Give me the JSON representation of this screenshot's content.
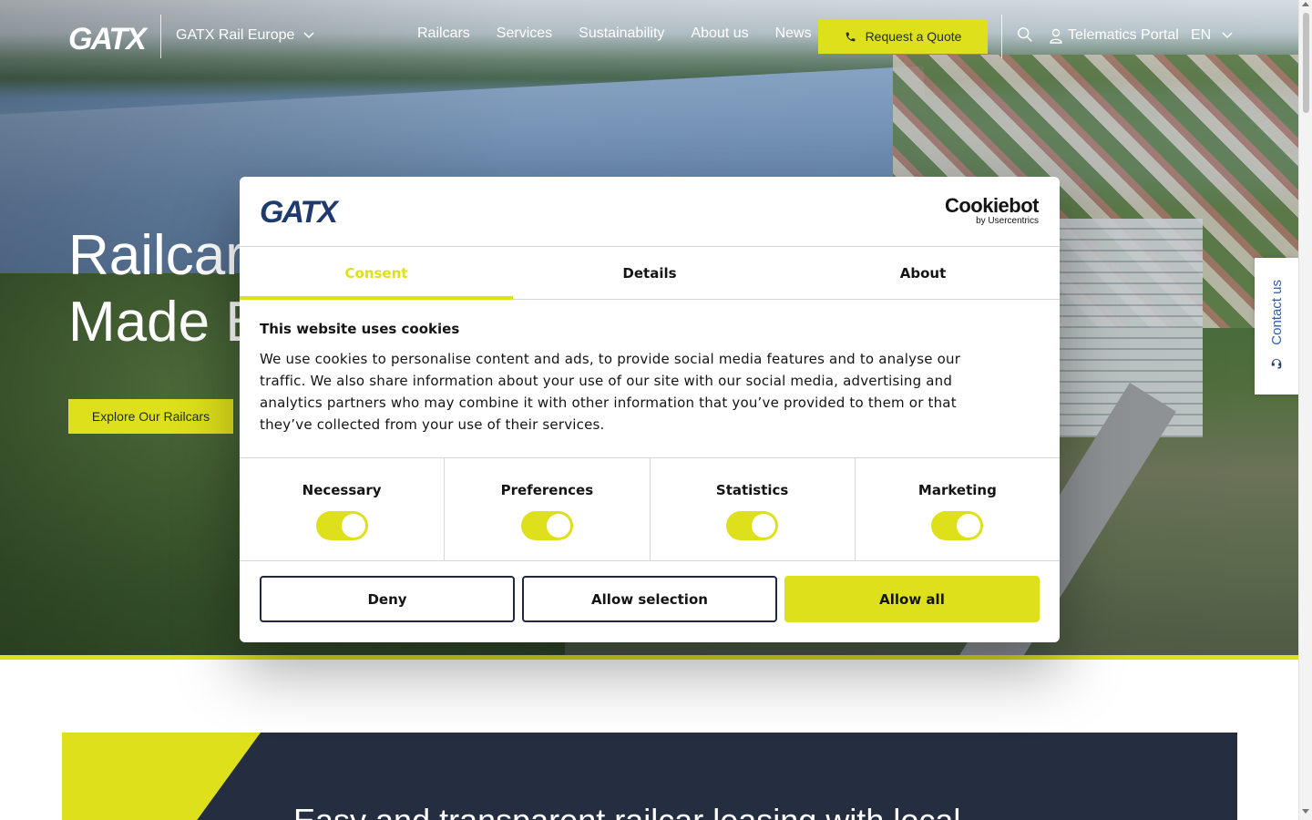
{
  "header": {
    "logo": "GATX",
    "region": "GATX Rail Europe",
    "nav": [
      "Railcars",
      "Services",
      "Sustainability",
      "About us",
      "News"
    ],
    "quote_button": "Request a Quote",
    "telematics": "Telematics Portal",
    "language": "EN"
  },
  "hero": {
    "title_line1": "Railcar",
    "title_line2": "Made E",
    "cta": "Explore Our Railcars"
  },
  "contact_tab": {
    "label": "Contact us"
  },
  "banner": {
    "text": "Easy and transparent railcar leasing with local"
  },
  "cookie_dialog": {
    "logo": "GATX",
    "provider": "Cookiebot",
    "provider_sub": "by Usercentrics",
    "tabs": [
      "Consent",
      "Details",
      "About"
    ],
    "active_tab": "Consent",
    "title": "This website uses cookies",
    "text": "We use cookies to personalise content and ads, to provide social media features and to analyse our traffic. We also share information about your use of our site with our social media, advertising and analytics partners who may combine it with other information that you’ve provided to them or that they’ve collected from your use of their services.",
    "toggles": [
      {
        "label": "Necessary",
        "on": true
      },
      {
        "label": "Preferences",
        "on": true
      },
      {
        "label": "Statistics",
        "on": true
      },
      {
        "label": "Marketing",
        "on": true
      }
    ],
    "buttons": {
      "deny": "Deny",
      "allow_selection": "Allow selection",
      "allow_all": "Allow all"
    }
  },
  "colors": {
    "accent": "#dde01a",
    "navy": "#252e40",
    "contact_blue": "#2f5da8"
  }
}
